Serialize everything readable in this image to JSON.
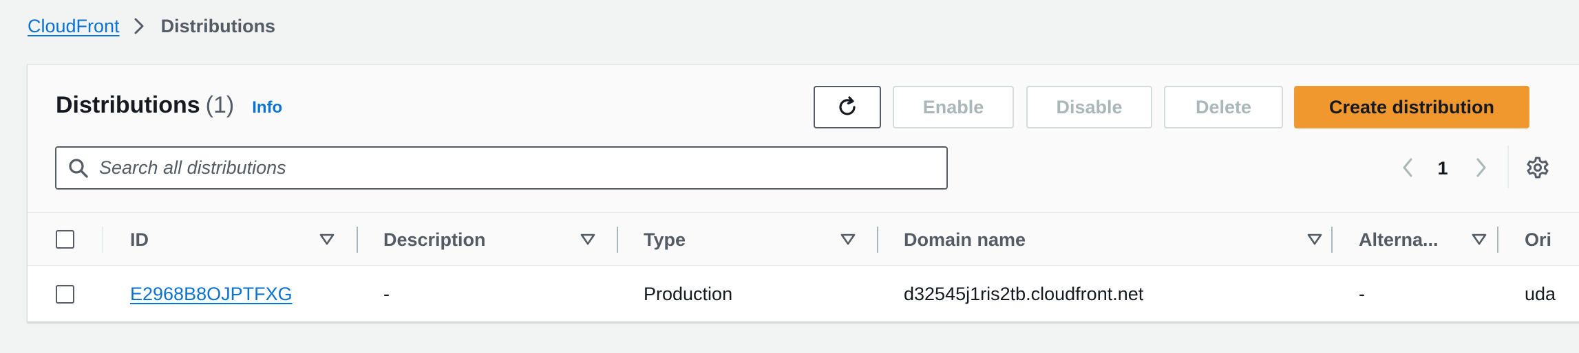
{
  "breadcrumb": {
    "parent": "CloudFront",
    "current": "Distributions"
  },
  "header": {
    "title": "Distributions",
    "count": "(1)",
    "info": "Info"
  },
  "toolbar": {
    "refresh_icon": "refresh-icon",
    "enable_label": "Enable",
    "disable_label": "Disable",
    "delete_label": "Delete",
    "create_label": "Create distribution",
    "create_color": "#ec7211"
  },
  "search": {
    "placeholder": "Search all distributions",
    "value": ""
  },
  "pagination": {
    "current_page": "1"
  },
  "table": {
    "columns": [
      "ID",
      "Description",
      "Type",
      "Domain name",
      "Alterna...",
      "Ori"
    ],
    "rows": [
      {
        "id": "E2968B8OJPTFXG",
        "description": "-",
        "type": "Production",
        "domain_name": "d32545j1ris2tb.cloudfront.net",
        "alternate": "-",
        "origin": "uda"
      }
    ]
  }
}
